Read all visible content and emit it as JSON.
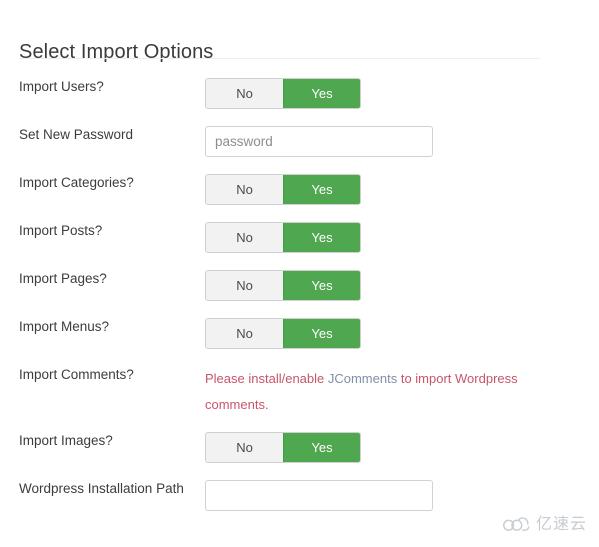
{
  "header": {
    "title": "Select Import Options"
  },
  "toggle": {
    "off_label": "No",
    "on_label": "Yes",
    "on_color": "#4fa74f",
    "off_color": "#f2f2f2"
  },
  "rows": [
    {
      "label": "Import Users?",
      "type": "toggle",
      "value": "Yes"
    },
    {
      "label": "Set New Password",
      "type": "input",
      "value": "",
      "placeholder": "password"
    },
    {
      "label": "Import Categories?",
      "type": "toggle",
      "value": "Yes"
    },
    {
      "label": "Import Posts?",
      "type": "toggle",
      "value": "Yes"
    },
    {
      "label": "Import Pages?",
      "type": "toggle",
      "value": "Yes"
    },
    {
      "label": "Import Menus?",
      "type": "toggle",
      "value": "Yes"
    },
    {
      "label": "Import Comments?",
      "type": "message",
      "message_before": "Please install/enable ",
      "message_link": "JComments",
      "message_after": " to import Wordpress comments.",
      "message_color": "#c8556a",
      "link_color": "#7f8fa8"
    },
    {
      "label": "Import Images?",
      "type": "toggle",
      "value": "Yes"
    },
    {
      "label": "Wordpress Installation Path",
      "type": "input",
      "value": "",
      "placeholder": ""
    }
  ],
  "watermark": {
    "icon": "cloud-logo-icon",
    "text": "亿速云"
  }
}
